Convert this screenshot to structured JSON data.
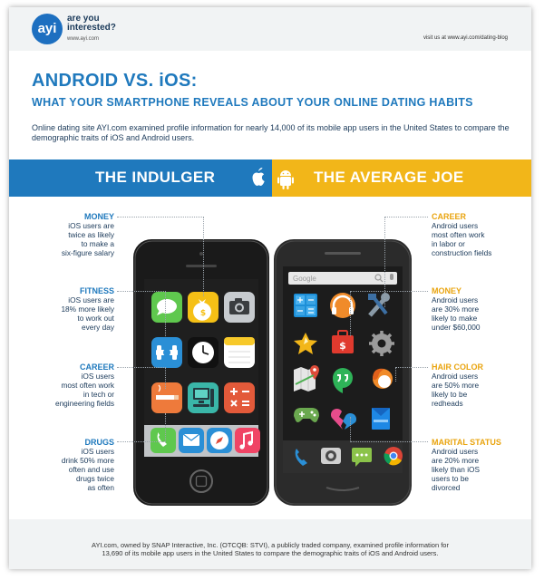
{
  "header": {
    "logo_text": "ayi",
    "tagline_line1": "are you",
    "tagline_line2": "interested?",
    "tagline_url": "www.ayi.com",
    "visit_text": "visit us at www.ayi.com/dating-blog"
  },
  "title": {
    "main": "ANDROID VS. iOS:",
    "sub": "WHAT YOUR SMARTPHONE REVEALS ABOUT YOUR ONLINE DATING HABITS"
  },
  "intro": "Online dating site AYI.com examined profile information for nearly 14,000 of its mobile app users in the United States to compare the demographic traits of iOS and Android users.",
  "banner": {
    "left_label": "THE INDULGER",
    "right_label": "THE AVERAGE JOE",
    "left_color": "#1f79bd",
    "right_color": "#f2b619"
  },
  "ios_facts": [
    {
      "heading": "MONEY",
      "lines": [
        "iOS users are",
        "twice as likely",
        "to make a",
        "six-figure salary"
      ]
    },
    {
      "heading": "FITNESS",
      "lines": [
        "iOS users are",
        "18% more likely",
        "to work out",
        "every day"
      ]
    },
    {
      "heading": "CAREER",
      "lines": [
        "iOS users",
        "most often work",
        "in tech or",
        "engineering fields"
      ]
    },
    {
      "heading": "DRUGS",
      "lines": [
        "iOS users",
        "drink 50% more",
        "often and use",
        "drugs twice",
        "as often"
      ]
    }
  ],
  "android_facts": [
    {
      "heading": "CAREER",
      "lines": [
        "Android users",
        "most often work",
        "in labor or",
        "construction fields"
      ]
    },
    {
      "heading": "MONEY",
      "lines": [
        "Android users",
        "are 30% more",
        "likely to make",
        "under $60,000"
      ]
    },
    {
      "heading": "HAIR COLOR",
      "lines": [
        "Android users",
        "are 50% more",
        "likely to be",
        "redheads"
      ]
    },
    {
      "heading": "MARITAL STATUS",
      "lines": [
        "Android users",
        "are 20% more",
        "likely than iOS",
        "users to be",
        "divorced"
      ]
    }
  ],
  "android_search_placeholder": "Google",
  "icons": {
    "ios_apps": [
      "messages-icon",
      "money-bag-icon",
      "camera-icon",
      "fitness-app-icon",
      "clock-icon",
      "notes-icon",
      "cigarette-icon",
      "computer-icon",
      "calculator-icon"
    ],
    "ios_dock": [
      "phone-icon",
      "mail-icon",
      "safari-icon",
      "music-icon"
    ],
    "android_apps": [
      "calculator-icon",
      "headphones-icon",
      "tools-icon",
      "sparkle-icon",
      "briefcase-icon",
      "settings-gear-icon",
      "maps-icon",
      "hangouts-icon",
      "redhead-icon",
      "game-controller-icon",
      "broken-heart-icon",
      "books-icon"
    ],
    "android_dock": [
      "phone-icon",
      "camera-icon",
      "messaging-icon",
      "chrome-icon"
    ]
  },
  "footer": {
    "line1": "AYI.com, owned by SNAP Interactive, Inc. (OTCQB: STVI), a publicly traded company, examined profile information for",
    "line2": "13,690 of its mobile app users in the United States to compare the demographic traits of iOS and Android users."
  }
}
